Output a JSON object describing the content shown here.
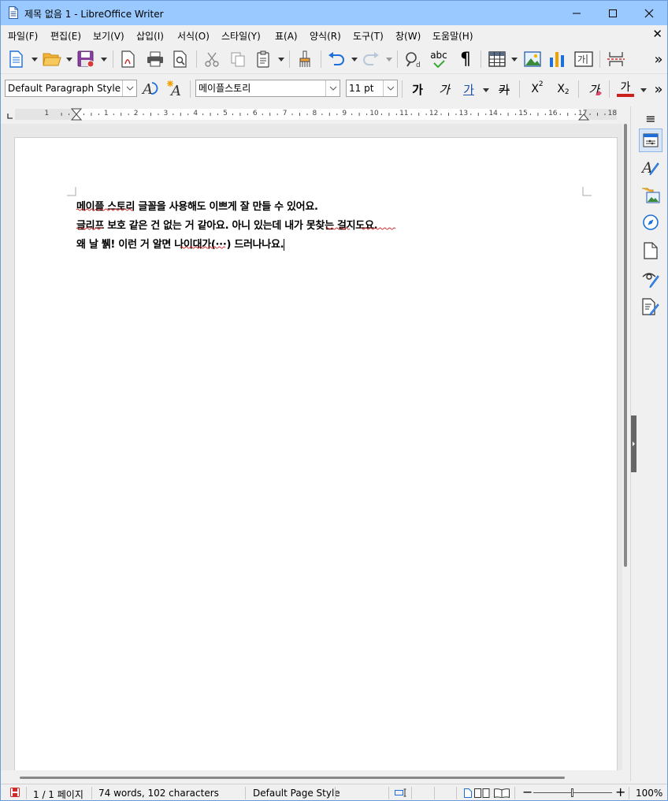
{
  "window": {
    "title": "제목 없음 1 - LibreOffice Writer"
  },
  "menu": {
    "items": [
      "파일(F)",
      "편집(E)",
      "보기(V)",
      "삽입(I)",
      "서식(O)",
      "스타일(Y)",
      "표(A)",
      "양식(R)",
      "도구(T)",
      "창(W)",
      "도움말(H)"
    ]
  },
  "formatting": {
    "paragraph_style": "Default Paragraph Style",
    "font_name": "메이플스토리",
    "font_size": "11 pt",
    "bold_glyph": "가",
    "italic_glyph": "가",
    "underline_glyph": "가",
    "strike_glyph": "카",
    "superscript_label": "X",
    "superscript_mark": "2",
    "subscript_label": "X",
    "subscript_mark": "2",
    "clear_glyph": "가",
    "font_color_glyph": "가"
  },
  "toolbar": {
    "spellcheck_label": "abc",
    "more_label": "»"
  },
  "ruler": {
    "marks": [
      "1",
      "1",
      "2",
      "3",
      "4",
      "5",
      "6",
      "7",
      "8",
      "9",
      "10",
      "11",
      "12",
      "13",
      "14",
      "15",
      "16",
      "17",
      "18"
    ]
  },
  "document": {
    "lines": [
      "메이플 스토리 글꼴을 사용해도 이쁘게 잘 만들 수 있어요.",
      "글리프 보호 같은 건 없는 거 같아요. 아니 있는데 내가 못찾는 걸지도요.",
      "왜 날 뷁! 이런 거 알면 나이대가(···) 드러나나요."
    ]
  },
  "statusbar": {
    "page": "1 / 1 페이지",
    "words": "74 words, 102 characters",
    "page_style": "Default Page Style",
    "zoom": "100%"
  },
  "colors": {
    "titlebar": "#99c9ff",
    "accent": "#1e6fd9",
    "font_color": "#c9211e"
  }
}
